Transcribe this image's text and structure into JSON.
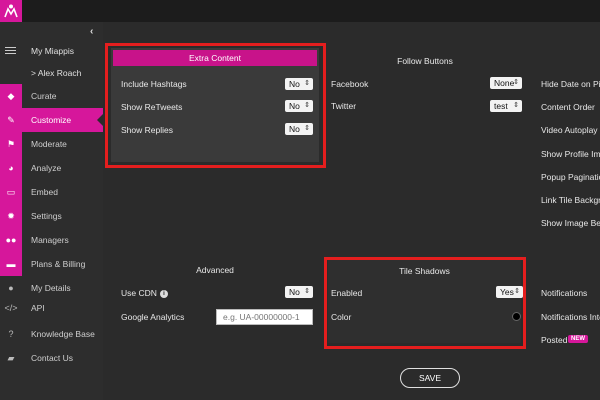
{
  "app": {
    "logo_icon": "miappis-logo-icon",
    "accent_color": "#d6179b",
    "highlight_color": "#e41e1e"
  },
  "sidebar": {
    "collapse_icon": "chevron-left-icon",
    "account": {
      "label": "My Miappis",
      "user": "> Alex Roach"
    },
    "items": [
      {
        "label": "Curate",
        "icon": "cube-icon"
      },
      {
        "label": "Customize",
        "icon": "pencil-icon",
        "active": true
      },
      {
        "label": "Moderate",
        "icon": "flag-icon"
      },
      {
        "label": "Analyze",
        "icon": "pie-chart-icon"
      },
      {
        "label": "Embed",
        "icon": "monitor-icon"
      },
      {
        "label": "Settings",
        "icon": "gear-icon"
      },
      {
        "label": "Managers",
        "icon": "users-icon"
      },
      {
        "label": "Plans & Billing",
        "icon": "credit-card-icon"
      },
      {
        "label": "My Details",
        "icon": "user-icon"
      },
      {
        "label": "API",
        "icon": "code-icon"
      },
      {
        "label": "Knowledge Base",
        "icon": "question-icon"
      },
      {
        "label": "Contact Us",
        "icon": "chat-icon"
      }
    ]
  },
  "extra_content": {
    "title": "Extra Content",
    "rows": [
      {
        "label": "Include Hashtags",
        "value": "No"
      },
      {
        "label": "Show ReTweets",
        "value": "No"
      },
      {
        "label": "Show Replies",
        "value": "No"
      }
    ]
  },
  "follow_buttons": {
    "title": "Follow Buttons",
    "rows": [
      {
        "label": "Facebook",
        "value": "None"
      },
      {
        "label": "Twitter",
        "value": "test"
      }
    ]
  },
  "right_column": {
    "items": [
      "Hide Date on Pin",
      "Content Order",
      "Video Autoplay",
      "Show Profile Ima",
      "Popup Paginatio",
      "Link Tile Backgro",
      "Show Image Belo"
    ]
  },
  "advanced": {
    "title": "Advanced",
    "use_cdn": {
      "label": "Use CDN",
      "value": "No",
      "info_icon": "info-icon"
    },
    "google_analytics": {
      "label": "Google Analytics",
      "placeholder": "e.g. UA-00000000-1"
    }
  },
  "tile_shadows": {
    "title": "Tile Shadows",
    "enabled": {
      "label": "Enabled",
      "value": "Yes"
    },
    "color": {
      "label": "Color",
      "value": "#000000"
    }
  },
  "notifications": {
    "items": [
      "Notifications",
      "Notifications Inte",
      "Posted"
    ],
    "new_badge": "NEW"
  },
  "save_label": "SAVE"
}
